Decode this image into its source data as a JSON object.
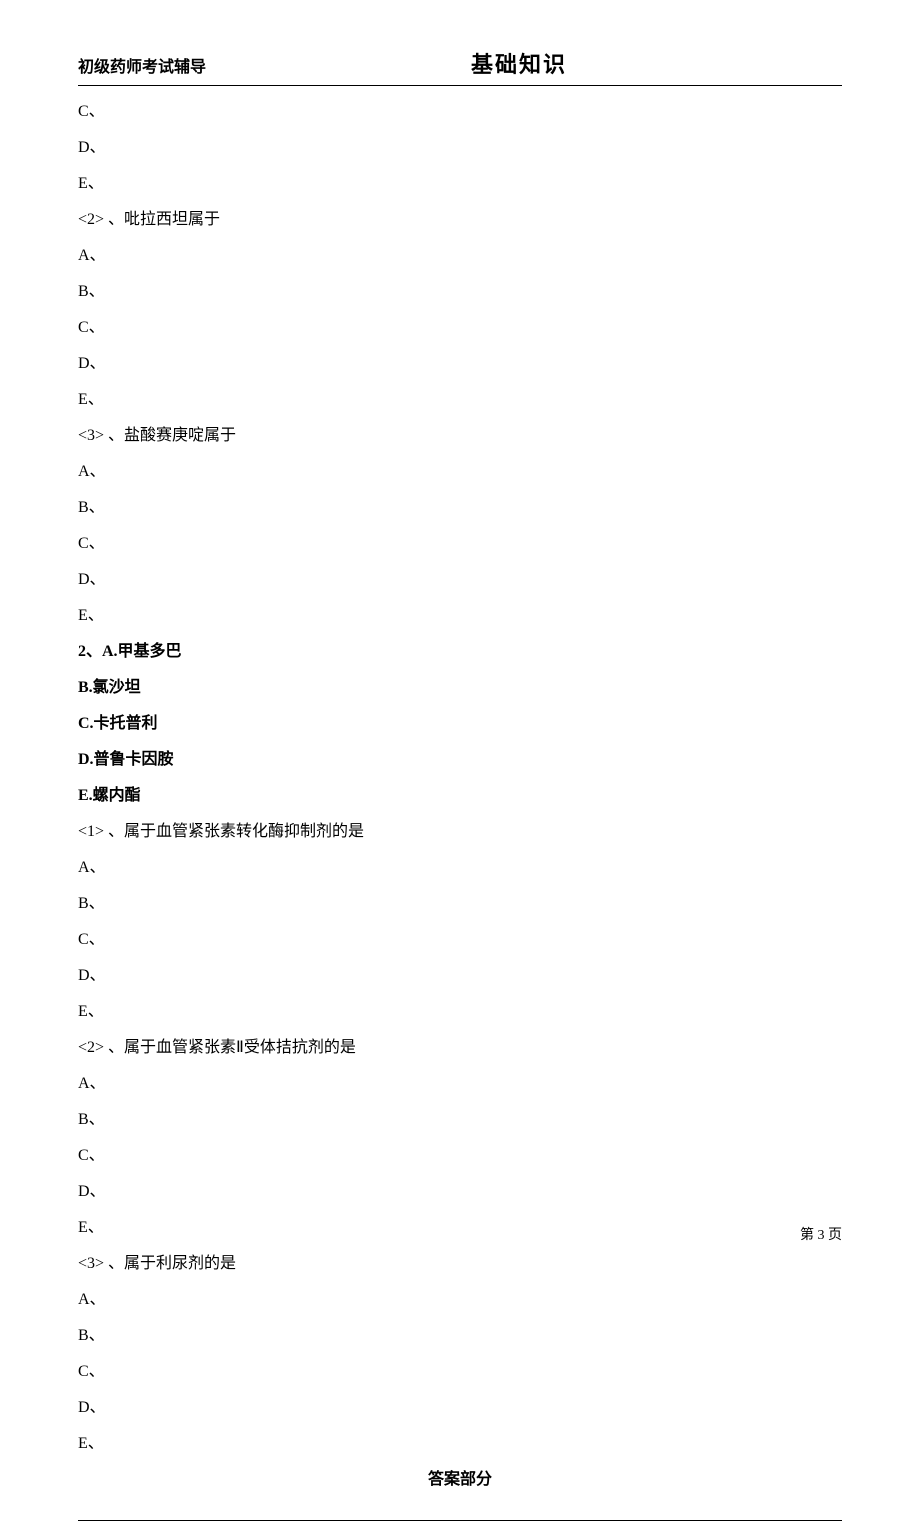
{
  "header": {
    "left": "初级药师考试辅导",
    "center": "基础知识"
  },
  "body": [
    {
      "t": "C、"
    },
    {
      "t": "D、"
    },
    {
      "t": "E、"
    },
    {
      "t": "<2> 、吡拉西坦属于"
    },
    {
      "t": "A、"
    },
    {
      "t": "B、"
    },
    {
      "t": "C、"
    },
    {
      "t": "D、"
    },
    {
      "t": "E、"
    },
    {
      "t": "<3> 、盐酸赛庚啶属于"
    },
    {
      "t": "A、"
    },
    {
      "t": "B、"
    },
    {
      "t": "C、"
    },
    {
      "t": "D、"
    },
    {
      "t": "E、"
    },
    {
      "t": "2、A.甲基多巴",
      "b": true
    },
    {
      "t": "B.氯沙坦",
      "b": true
    },
    {
      "t": "C.卡托普利",
      "b": true
    },
    {
      "t": "D.普鲁卡因胺",
      "b": true
    },
    {
      "t": "E.螺内酯",
      "b": true
    },
    {
      "t": "<1> 、属于血管紧张素转化酶抑制剂的是"
    },
    {
      "t": "A、"
    },
    {
      "t": "B、"
    },
    {
      "t": "C、"
    },
    {
      "t": "D、"
    },
    {
      "t": "E、"
    },
    {
      "t": "<2> 、属于血管紧张素Ⅱ受体拮抗剂的是"
    },
    {
      "t": "A、"
    },
    {
      "t": "B、"
    },
    {
      "t": "C、"
    },
    {
      "t": "D、"
    },
    {
      "t": "E、"
    },
    {
      "t": "<3> 、属于利尿剂的是"
    },
    {
      "t": "A、"
    },
    {
      "t": "B、"
    },
    {
      "t": "C、"
    },
    {
      "t": "D、"
    },
    {
      "t": "E、"
    }
  ],
  "answers_title": "答案部分",
  "page_number": "第 3 页"
}
